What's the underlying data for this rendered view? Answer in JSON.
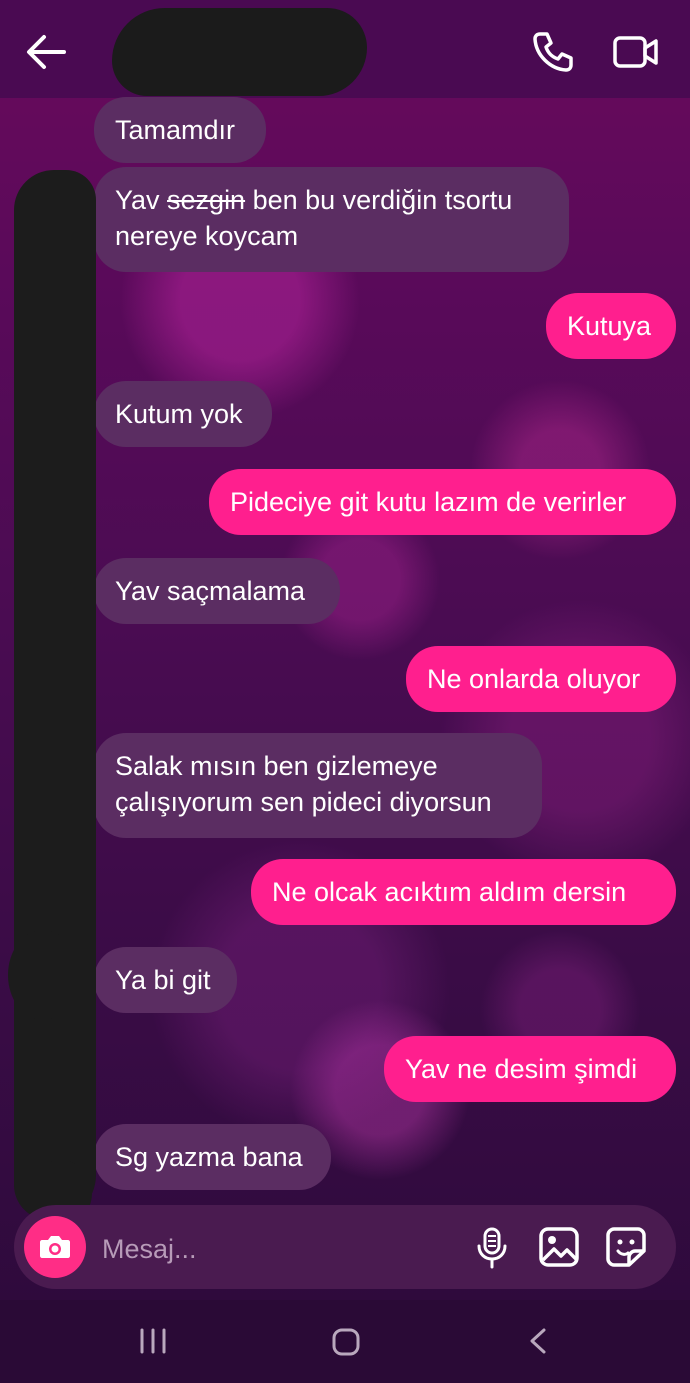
{
  "colors": {
    "header_bg": "#4a0a52",
    "incoming_bubble": "#5b2d62",
    "outgoing_bubble": "#ff1f8e",
    "accent_pink": "#ff2d86"
  },
  "header": {
    "contact_name_redacted": true,
    "icons": [
      "arrow-left-icon",
      "phone-icon",
      "video-camera-icon"
    ]
  },
  "messages": [
    {
      "direction": "in",
      "text": "Tamamdır"
    },
    {
      "direction": "in",
      "line1_prefix": "Yav ",
      "line1_struck": "sezgin",
      "line1_suffix": " ben bu verdiğin tsortu",
      "line2": "nereye koycam"
    },
    {
      "direction": "out",
      "text": "Kutuya"
    },
    {
      "direction": "in",
      "text": "Kutum yok"
    },
    {
      "direction": "out",
      "text": "Pideciye git kutu lazım de verirler"
    },
    {
      "direction": "in",
      "text": "Yav saçmalama"
    },
    {
      "direction": "out",
      "text": "Ne onlarda oluyor"
    },
    {
      "direction": "in",
      "line1": "Salak mısın ben gizlemeye",
      "line2": "çalışıyorum sen pideci diyorsun"
    },
    {
      "direction": "out",
      "text": "Ne olcak acıktım aldım dersin"
    },
    {
      "direction": "in",
      "text": "Ya bi git"
    },
    {
      "direction": "out",
      "text": "Yav ne desim şimdi"
    },
    {
      "direction": "in",
      "text": "Sg yazma bana"
    }
  ],
  "composer": {
    "placeholder": "Mesaj...",
    "icons": [
      "camera-icon",
      "microphone-icon",
      "image-icon",
      "sticker-icon"
    ]
  },
  "navbar": {
    "icons": [
      "recent-apps-icon",
      "home-icon",
      "nav-back-icon"
    ]
  }
}
